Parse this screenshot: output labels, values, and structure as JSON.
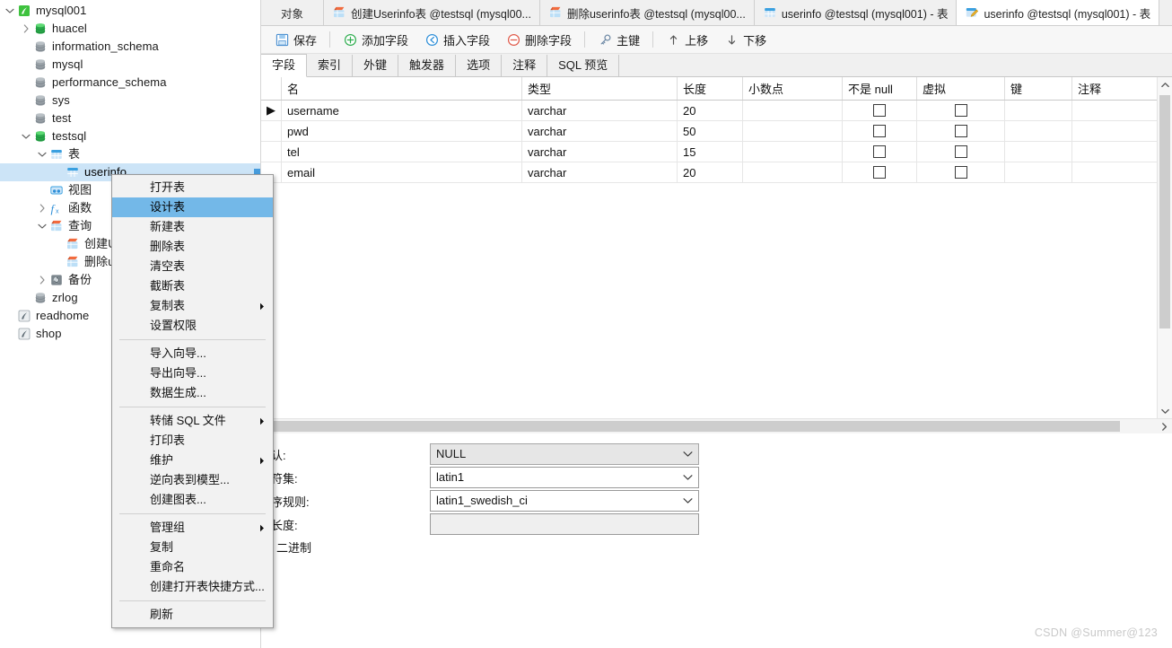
{
  "sidebar": {
    "nodes": [
      {
        "label": "mysql001",
        "icon": "connection-icon",
        "indent": 0,
        "twist": "down",
        "iconType": "conn"
      },
      {
        "label": "huacel",
        "icon": "database-green-icon",
        "indent": 1,
        "twist": "right",
        "iconType": "db-green"
      },
      {
        "label": "information_schema",
        "icon": "database-icon",
        "indent": 1,
        "twist": "none",
        "iconType": "db-gray"
      },
      {
        "label": "mysql",
        "icon": "database-icon",
        "indent": 1,
        "twist": "none",
        "iconType": "db-gray"
      },
      {
        "label": "performance_schema",
        "icon": "database-icon",
        "indent": 1,
        "twist": "none",
        "iconType": "db-gray"
      },
      {
        "label": "sys",
        "icon": "database-icon",
        "indent": 1,
        "twist": "none",
        "iconType": "db-gray"
      },
      {
        "label": "test",
        "icon": "database-icon",
        "indent": 1,
        "twist": "none",
        "iconType": "db-gray"
      },
      {
        "label": "testsql",
        "icon": "database-green-icon",
        "indent": 1,
        "twist": "down",
        "iconType": "db-green"
      },
      {
        "label": "表",
        "icon": "tables-folder-icon",
        "indent": 2,
        "twist": "down",
        "iconType": "table"
      },
      {
        "label": "userinfo",
        "icon": "table-icon",
        "indent": 3,
        "twist": "none",
        "iconType": "table",
        "selected": true
      },
      {
        "label": "视图",
        "icon": "views-icon",
        "indent": 2,
        "twist": "none",
        "iconType": "view"
      },
      {
        "label": "函数",
        "icon": "functions-icon",
        "indent": 2,
        "twist": "right",
        "iconType": "func"
      },
      {
        "label": "查询",
        "icon": "queries-icon",
        "indent": 2,
        "twist": "down",
        "iconType": "query"
      },
      {
        "label": "创建Use",
        "icon": "query-icon",
        "indent": 3,
        "twist": "none",
        "iconType": "query"
      },
      {
        "label": "删除user",
        "icon": "query-icon",
        "indent": 3,
        "twist": "none",
        "iconType": "query"
      },
      {
        "label": "备份",
        "icon": "backup-icon",
        "indent": 2,
        "twist": "right",
        "iconType": "backup"
      },
      {
        "label": "zrlog",
        "icon": "database-icon",
        "indent": 1,
        "twist": "none",
        "iconType": "db-gray"
      },
      {
        "label": "readhome",
        "icon": "connection-icon",
        "indent": 0,
        "twist": "none",
        "iconType": "conn-gray"
      },
      {
        "label": "shop",
        "icon": "connection-icon",
        "indent": 0,
        "twist": "none",
        "iconType": "conn-gray"
      }
    ]
  },
  "window_tabs": [
    {
      "label": "对象",
      "icon": "objects-icon",
      "active": false,
      "kind": "objects"
    },
    {
      "label": "创建Userinfo表 @testsql (mysql00...",
      "icon": "query-icon",
      "active": false,
      "kind": "query"
    },
    {
      "label": "删除userinfo表 @testsql (mysql00...",
      "icon": "query-icon",
      "active": false,
      "kind": "query"
    },
    {
      "label": "userinfo @testsql (mysql001) - 表",
      "icon": "table-icon",
      "active": false,
      "kind": "table"
    },
    {
      "label": "userinfo @testsql (mysql001) - 表",
      "icon": "table-design-icon",
      "active": true,
      "kind": "design"
    }
  ],
  "toolbar": {
    "save_label": "保存",
    "add_field_label": "添加字段",
    "insert_field_label": "插入字段",
    "delete_field_label": "删除字段",
    "primary_key_label": "主键",
    "move_up_label": "上移",
    "move_down_label": "下移"
  },
  "inner_tabs": [
    {
      "label": "字段",
      "active": true
    },
    {
      "label": "索引",
      "active": false
    },
    {
      "label": "外键",
      "active": false
    },
    {
      "label": "触发器",
      "active": false
    },
    {
      "label": "选项",
      "active": false
    },
    {
      "label": "注释",
      "active": false
    },
    {
      "label": "SQL 预览",
      "active": false
    }
  ],
  "grid": {
    "columns": [
      "名",
      "类型",
      "长度",
      "小数点",
      "不是 null",
      "虚拟",
      "键",
      "注释"
    ],
    "rows": [
      {
        "marker": "▶",
        "name": "username",
        "type": "varchar",
        "length": "20",
        "decimals": "",
        "notnull": false,
        "virtual": false,
        "key": "",
        "comment": ""
      },
      {
        "marker": "",
        "name": "pwd",
        "type": "varchar",
        "length": "50",
        "decimals": "",
        "notnull": false,
        "virtual": false,
        "key": "",
        "comment": ""
      },
      {
        "marker": "",
        "name": "tel",
        "type": "varchar",
        "length": "15",
        "decimals": "",
        "notnull": false,
        "virtual": false,
        "key": "",
        "comment": ""
      },
      {
        "marker": "",
        "name": "email",
        "type": "varchar",
        "length": "20",
        "decimals": "",
        "notnull": false,
        "virtual": false,
        "key": "",
        "comment": ""
      }
    ]
  },
  "properties": {
    "default_label": "默认:",
    "default_value": "NULL",
    "charset_label": "字符集:",
    "charset_value": "latin1",
    "collation_label": "排序规则:",
    "collation_value": "latin1_swedish_ci",
    "keylength_label": "键长度:",
    "keylength_value": "",
    "binary_label": "二进制"
  },
  "context_menu": {
    "items": [
      {
        "label": "打开表",
        "submenu": false,
        "highlight": false
      },
      {
        "label": "设计表",
        "submenu": false,
        "highlight": true
      },
      {
        "label": "新建表",
        "submenu": false,
        "highlight": false
      },
      {
        "label": "删除表",
        "submenu": false,
        "highlight": false
      },
      {
        "label": "清空表",
        "submenu": false,
        "highlight": false
      },
      {
        "label": "截断表",
        "submenu": false,
        "highlight": false
      },
      {
        "label": "复制表",
        "submenu": true,
        "highlight": false
      },
      {
        "label": "设置权限",
        "submenu": false,
        "highlight": false
      },
      {
        "separator": true
      },
      {
        "label": "导入向导...",
        "submenu": false,
        "highlight": false
      },
      {
        "label": "导出向导...",
        "submenu": false,
        "highlight": false
      },
      {
        "label": "数据生成...",
        "submenu": false,
        "highlight": false
      },
      {
        "separator": true
      },
      {
        "label": "转储 SQL 文件",
        "submenu": true,
        "highlight": false
      },
      {
        "label": "打印表",
        "submenu": false,
        "highlight": false
      },
      {
        "label": "维护",
        "submenu": true,
        "highlight": false
      },
      {
        "label": "逆向表到模型...",
        "submenu": false,
        "highlight": false
      },
      {
        "label": "创建图表...",
        "submenu": false,
        "highlight": false
      },
      {
        "separator": true
      },
      {
        "label": "管理组",
        "submenu": true,
        "highlight": false
      },
      {
        "label": "复制",
        "submenu": false,
        "highlight": false
      },
      {
        "label": "重命名",
        "submenu": false,
        "highlight": false
      },
      {
        "label": "创建打开表快捷方式...",
        "submenu": false,
        "highlight": false
      },
      {
        "separator": true
      },
      {
        "label": "刷新",
        "submenu": false,
        "highlight": false
      }
    ]
  },
  "watermark": "CSDN @Summer@123",
  "colors": {
    "selection": "#cce4f7",
    "menu_highlight": "#73b8e8",
    "toolbar_bg": "#f7f7f7",
    "tabstrip_bg": "#f0f0f0",
    "green": "#2fad4f",
    "blue": "#2f8fd8",
    "red": "#e05a4a"
  }
}
